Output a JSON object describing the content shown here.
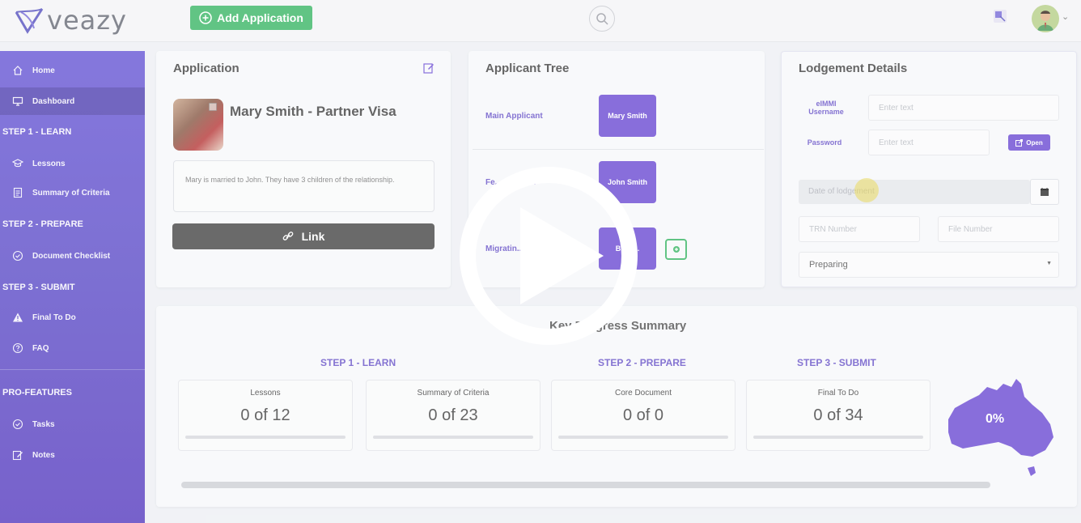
{
  "header": {
    "logo_text": "veazy",
    "add_application_label": "Add Application"
  },
  "sidebar": {
    "items": [
      {
        "label": "Home",
        "icon": "home-icon"
      },
      {
        "label": "Dashboard",
        "icon": "monitor-icon",
        "active": true
      },
      {
        "label": "Lessons",
        "icon": "graduation-cap-icon"
      },
      {
        "label": "Summary of Criteria",
        "icon": "document-icon"
      },
      {
        "label": "Document Checklist",
        "icon": "check-circle-icon"
      },
      {
        "label": "Final To Do",
        "icon": "warning-icon"
      },
      {
        "label": "FAQ",
        "icon": "question-circle-icon"
      },
      {
        "label": "Tasks",
        "icon": "check-circle-icon"
      },
      {
        "label": "Notes",
        "icon": "edit-note-icon"
      }
    ],
    "headings": [
      "STEP 1 - LEARN",
      "STEP 2 - PREPARE",
      "STEP 3 - SUBMIT",
      "PRO-FEATURES"
    ]
  },
  "application": {
    "title": "Application",
    "name": "Mary Smith - Partner Visa",
    "note": "Mary is married to John. They have 3 children of the relationship.",
    "link_label": "Link"
  },
  "applicant_tree": {
    "title": "Applicant Tree",
    "rows": [
      {
        "label": "Main Applicant",
        "box": "Mary Smith"
      },
      {
        "label": "Fe... Sponsor",
        "box": "John Smith"
      },
      {
        "label": "Migratin...",
        "box": "B... L..."
      }
    ]
  },
  "lodgement": {
    "title": "Lodgement Details",
    "username_label": "eIMMI Username",
    "username_placeholder": "Enter text",
    "password_label": "Password",
    "password_placeholder": "Enter text",
    "open_label": "Open",
    "date_placeholder": "Date of lodgement",
    "trn_placeholder": "TRN Number",
    "file_placeholder": "File Number",
    "status_value": "Preparing"
  },
  "summary": {
    "title": "Key Progress Summary",
    "steps": [
      "STEP 1 - LEARN",
      "STEP 2 - PREPARE",
      "STEP 3 - SUBMIT"
    ],
    "stats": [
      {
        "label": "Lessons",
        "value": "0 of 12",
        "progress": 0
      },
      {
        "label": "Summary of Criteria",
        "value": "0 of 23",
        "progress": 0
      },
      {
        "label": "Core Document",
        "value": "0 of 0",
        "progress": 0
      },
      {
        "label": "Final To Do",
        "value": "0 of 34",
        "progress": 0
      }
    ],
    "overall_percent": "0%"
  },
  "colors": {
    "accent": "#6e4fd4",
    "green": "#3fb86a",
    "dark_button": "#4a4a4a"
  }
}
